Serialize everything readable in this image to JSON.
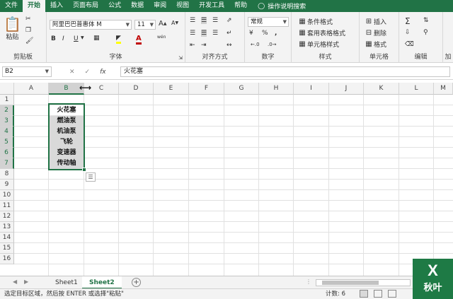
{
  "ribbon_tabs": [
    "文件",
    "开始",
    "插入",
    "页面布局",
    "公式",
    "数据",
    "审阅",
    "视图",
    "开发工具",
    "帮助"
  ],
  "tell_me": "操作说明搜索",
  "clipboard": {
    "paste": "粘贴",
    "label": "剪贴板"
  },
  "font": {
    "name": "阿里巴巴普惠体 M",
    "size": "11",
    "bold": "B",
    "italic": "I",
    "underline": "U",
    "grow": "A",
    "shrink": "A",
    "label": "字体",
    "wen": "wén"
  },
  "alignment": {
    "label": "对齐方式"
  },
  "number": {
    "format": "常规",
    "label": "数字",
    "percent": "%",
    "comma": ","
  },
  "styles": {
    "conditional": "条件格式",
    "table": "套用表格格式",
    "cell": "单元格样式",
    "label": "样式"
  },
  "cells": {
    "insert": "插入",
    "delete": "删除",
    "format": "格式",
    "label": "单元格"
  },
  "editing": {
    "label": "编辑",
    "sum": "Σ"
  },
  "addins": {
    "label": "加"
  },
  "formula_bar": {
    "name_box": "B2",
    "cancel": "✕",
    "enter": "✓",
    "fx": "fx",
    "content": "火花塞"
  },
  "columns": [
    "A",
    "B",
    "C",
    "D",
    "E",
    "F",
    "G",
    "H",
    "I",
    "J",
    "K",
    "L",
    "M"
  ],
  "rows": [
    "1",
    "2",
    "3",
    "4",
    "5",
    "6",
    "7",
    "8",
    "9",
    "10",
    "11",
    "12",
    "13",
    "14",
    "15",
    "16"
  ],
  "cells_data": [
    {
      "row": "2",
      "value": "火花塞"
    },
    {
      "row": "3",
      "value": "燃油泵"
    },
    {
      "row": "4",
      "value": "机油泵"
    },
    {
      "row": "5",
      "value": "飞轮"
    },
    {
      "row": "6",
      "value": "变速器"
    },
    {
      "row": "7",
      "value": "传动轴"
    }
  ],
  "sheets": [
    "Sheet1",
    "Sheet2"
  ],
  "active_sheet": "Sheet2",
  "status": {
    "message": "选定目标区域，然后按 ENTER 或选择\"粘贴\"",
    "count": "计数: 6"
  },
  "logo": {
    "top": "X",
    "bottom": "秋叶"
  },
  "colors": {
    "excel_green": "#217346",
    "ribbon_bg": "#f3f3f3",
    "fill_gray": "#d9d9d9"
  }
}
